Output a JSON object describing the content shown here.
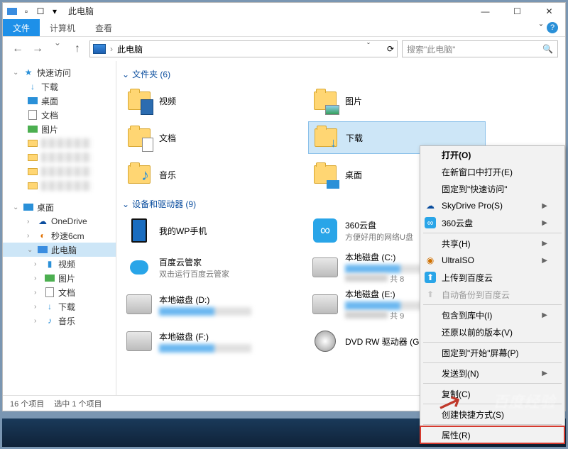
{
  "window": {
    "title": "此电脑",
    "controls": {
      "min": "—",
      "max": "☐",
      "close": "✕"
    }
  },
  "ribbon": {
    "tabs": [
      "文件",
      "计算机",
      "查看"
    ],
    "chevron": "ˇ",
    "help": "?"
  },
  "nav": {
    "back": "←",
    "fwd": "→",
    "drop": "ˇ",
    "up": "↑",
    "path_label": "此电脑",
    "path_sep": "›",
    "addr_drop": "ˇ",
    "refresh": "⟳"
  },
  "search": {
    "placeholder": "搜索\"此电脑\"",
    "icon": "🔍"
  },
  "sidebar": {
    "quick": "快速访问",
    "downloads": "下载",
    "desktop": "桌面",
    "documents": "文档",
    "pictures": "图片",
    "desktop2": "桌面",
    "onedrive": "OneDrive",
    "miaosu": "秒速6cm",
    "thispc": "此电脑",
    "videos": "视频",
    "pictures2": "图片",
    "documents2": "文档",
    "downloads2": "下载",
    "music": "音乐"
  },
  "groups": {
    "folders": {
      "title": "文件夹 (6)",
      "chev": "⌄"
    },
    "devices": {
      "title": "设备和驱动器 (9)",
      "chev": "⌄"
    }
  },
  "folders": {
    "videos": "视频",
    "pictures": "图片",
    "documents": "文档",
    "downloads": "下载",
    "music": "音乐",
    "desktop": "桌面"
  },
  "devices": {
    "wp": "我的WP手机",
    "cloud360_t": "360云盘",
    "cloud360_s": "方便好用的网络U盘",
    "bdy_t": "百度云管家",
    "bdy_s": "双击运行百度云管家",
    "c": "本地磁盘 (C:)",
    "d": "本地磁盘 (D:)",
    "e": "本地磁盘 (E:)",
    "f": "本地磁盘 (F:)",
    "dvd": "DVD RW 驱动器 (G:)",
    "total8": "共 8",
    "total9": "共 9"
  },
  "status": {
    "count": "16 个项目",
    "sel": "选中 1 个项目"
  },
  "ctx": {
    "open": "打开(O)",
    "open_new": "在新窗口中打开(E)",
    "pin_quick": "固定到\"快速访问\"",
    "skydrive": "SkyDrive Pro(S)",
    "c360": "360云盘",
    "share": "共享(H)",
    "ultraiso": "UltraISO",
    "upload_bdy": "上传到百度云",
    "backup_bdy": "自动备份到百度云",
    "include": "包含到库中(I)",
    "restore": "还原以前的版本(V)",
    "pin_start": "固定到\"开始\"屏幕(P)",
    "sendto": "发送到(N)",
    "copy": "复制(C)",
    "shortcut": "创建快捷方式(S)",
    "props": "属性(R)"
  },
  "ctx_icons": {
    "cloud": "☁",
    "c360": "∞",
    "circle": "◉",
    "bdy": "⬆"
  }
}
